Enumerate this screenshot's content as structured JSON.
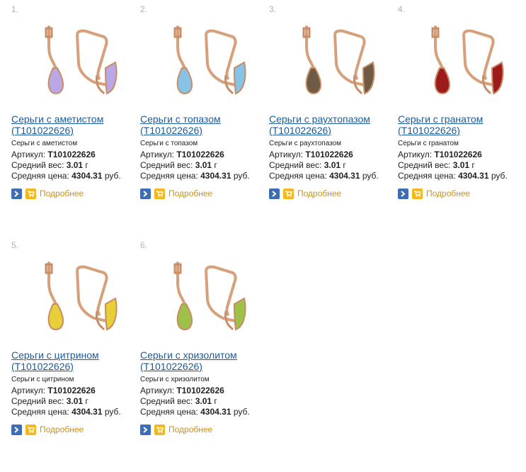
{
  "labels": {
    "article": "Артикул:",
    "weight": "Средний вес:",
    "price": "Средняя цена:",
    "more": "Подробнее"
  },
  "colors": {
    "link": "#1a5a9c",
    "more": "#c9921a",
    "go_button": "#3f6cb2",
    "cart_button": "#f5b81c",
    "gold": "#d7a07a"
  },
  "products": [
    {
      "number": "1.",
      "title": "Серьги с аметистом",
      "title_article": "(T101022626)",
      "subtitle": "Серьги с аметистом",
      "article": "T101022626",
      "weight": "3.01",
      "weight_unit": "г",
      "price": "4304.31",
      "currency": "руб.",
      "gem_color": "#b9a7e6"
    },
    {
      "number": "2.",
      "title": "Серьги с топазом",
      "title_article": "(T101022626)",
      "subtitle": "Серьги с топазом",
      "article": "T101022626",
      "weight": "3.01",
      "weight_unit": "г",
      "price": "4304.31",
      "currency": "руб.",
      "gem_color": "#86c3e6"
    },
    {
      "number": "3.",
      "title": "Серьги с раухтопазом",
      "title_article": "(T101022626)",
      "subtitle": "Серьги с раухтопазом",
      "article": "T101022626",
      "weight": "3.01",
      "weight_unit": "г",
      "price": "4304.31",
      "currency": "руб.",
      "gem_color": "#6f5b45"
    },
    {
      "number": "4.",
      "title": "Серьги с гранатом",
      "title_article": "(T101022626)",
      "subtitle": "Серьги с гранатом",
      "article": "T101022626",
      "weight": "3.01",
      "weight_unit": "г",
      "price": "4304.31",
      "currency": "руб.",
      "gem_color": "#9c1c1c"
    },
    {
      "number": "5.",
      "title": "Серьги с цитрином",
      "title_article": "(T101022626)",
      "subtitle": "Серьги с цитрином",
      "article": "T101022626",
      "weight": "3.01",
      "weight_unit": "г",
      "price": "4304.31",
      "currency": "руб.",
      "gem_color": "#e7cf3a"
    },
    {
      "number": "6.",
      "title": "Серьги с хризолитом",
      "title_article": "(T101022626)",
      "subtitle": "Серьги с хризолитом",
      "article": "T101022626",
      "weight": "3.01",
      "weight_unit": "г",
      "price": "4304.31",
      "currency": "руб.",
      "gem_color": "#9cc24a"
    }
  ]
}
